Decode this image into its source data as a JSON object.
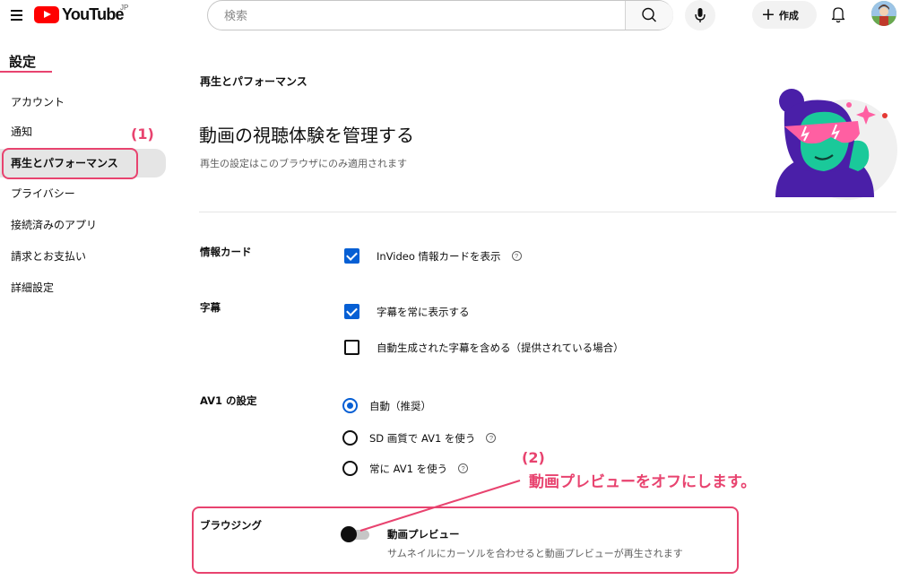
{
  "header": {
    "logo_text": "YouTube",
    "region": "JP",
    "search_placeholder": "検索",
    "create_label": "作成"
  },
  "sidebar": {
    "title": "設定",
    "items": [
      {
        "label": "アカウント"
      },
      {
        "label": "通知"
      },
      {
        "label": "再生とパフォーマンス"
      },
      {
        "label": "プライバシー"
      },
      {
        "label": "接続済みのアプリ"
      },
      {
        "label": "請求とお支払い"
      },
      {
        "label": "詳細設定"
      }
    ],
    "active_index": 2
  },
  "main": {
    "section_label": "再生とパフォーマンス",
    "heading": "動画の視聴体験を管理する",
    "subheading": "再生の設定はこのブラウザにのみ適用されます",
    "info_cards": {
      "label": "情報カード",
      "option": "InVideo 情報カードを表示",
      "checked": true
    },
    "captions": {
      "label": "字幕",
      "options": [
        {
          "text": "字幕を常に表示する",
          "checked": true
        },
        {
          "text": "自動生成された字幕を含める（提供されている場合）",
          "checked": false
        }
      ]
    },
    "av1": {
      "label": "AV1 の設定",
      "options": [
        {
          "text": "自動（推奨）",
          "selected": true
        },
        {
          "text": "SD 画質で AV1 を使う",
          "selected": false
        },
        {
          "text": "常に AV1 を使う",
          "selected": false
        }
      ]
    },
    "browsing": {
      "label": "ブラウジング",
      "toggle_title": "動画プレビュー",
      "toggle_desc": "サムネイルにカーソルを合わせると動画プレビューが再生されます",
      "enabled": false
    }
  },
  "annotations": {
    "step1": "(1)",
    "step2": "(2)",
    "step2_text": "動画プレビューをオフにします。",
    "color": "#e8436f"
  },
  "help_icon_glyph": "?",
  "colors": {
    "accent_blue": "#065fd4",
    "brand_red": "#ff0000",
    "annotation_pink": "#e8436f"
  }
}
